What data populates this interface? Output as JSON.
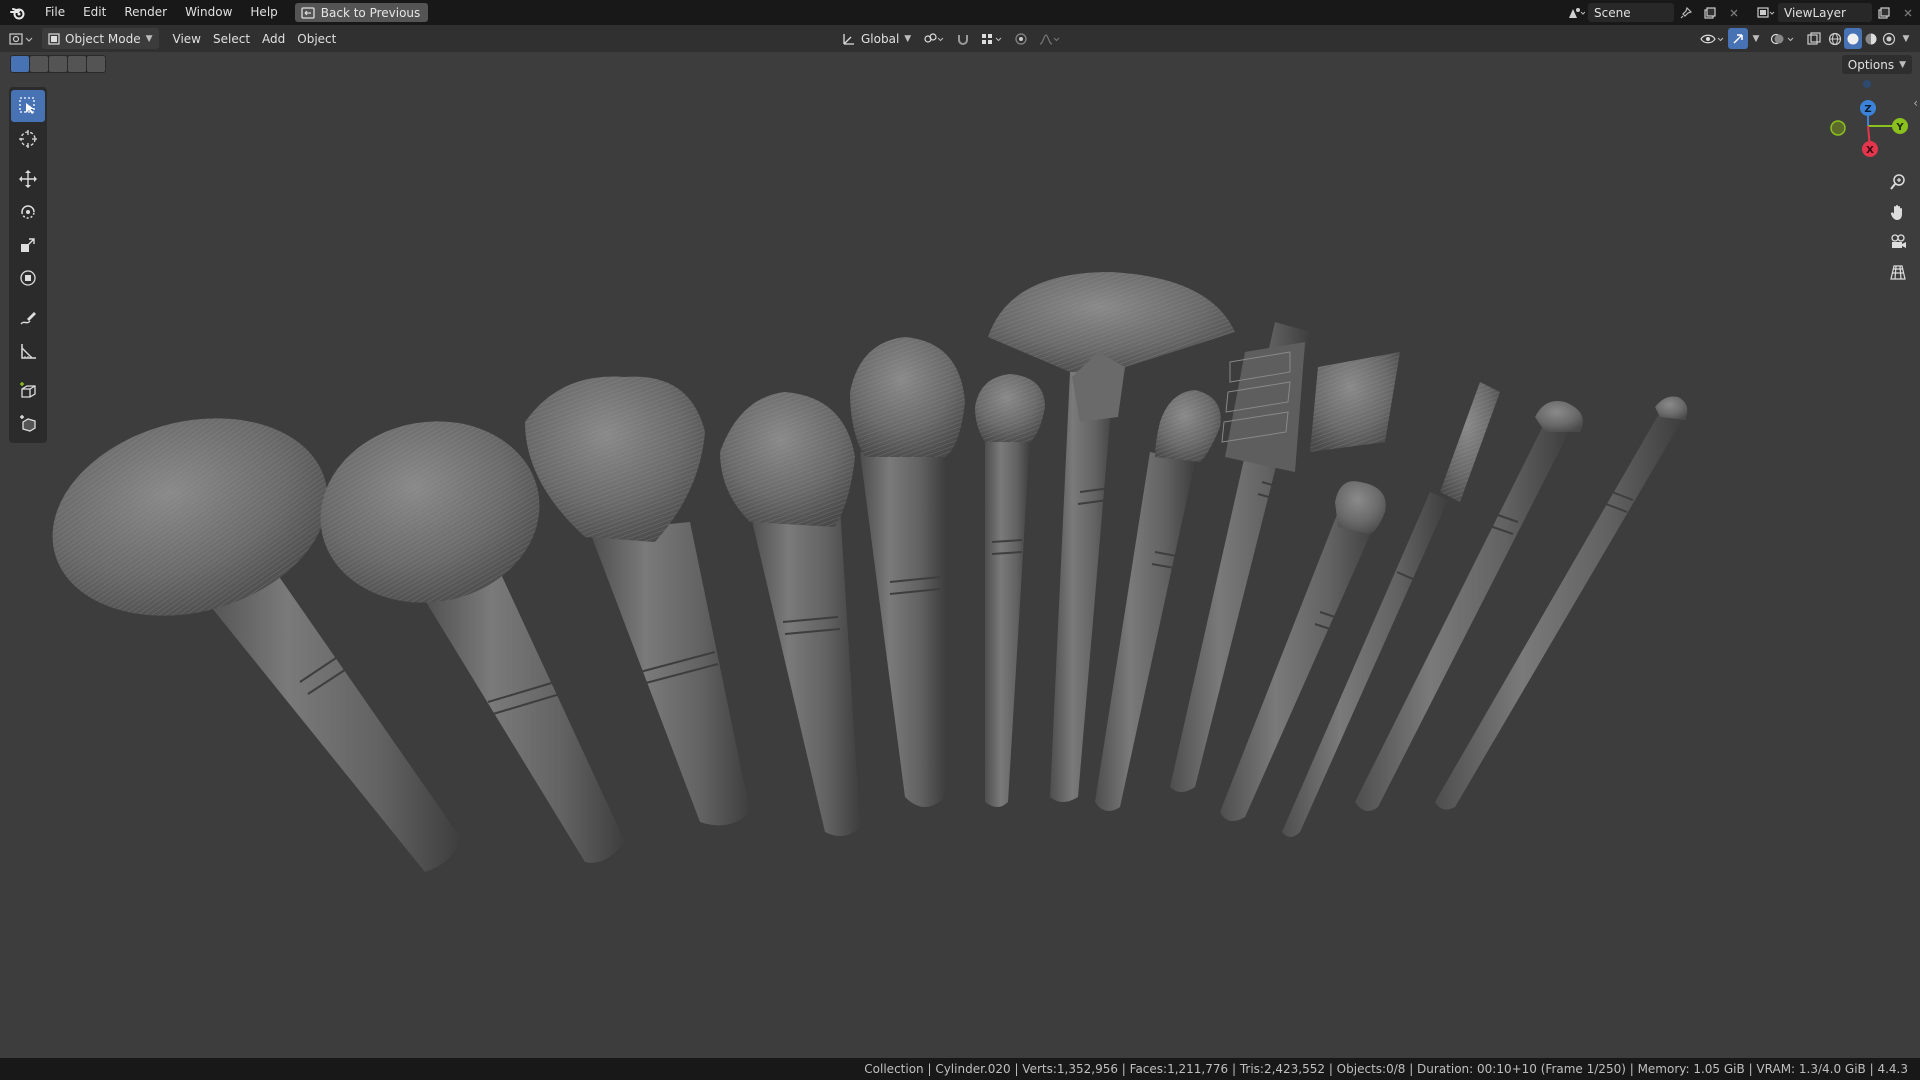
{
  "menubar": {
    "items": [
      "File",
      "Edit",
      "Render",
      "Window",
      "Help"
    ],
    "back_label": "Back to Previous",
    "scene_name": "Scene",
    "view_layer_name": "ViewLayer"
  },
  "header": {
    "mode_label": "Object Mode",
    "menus": [
      "View",
      "Select",
      "Add",
      "Object"
    ],
    "orientation_label": "Global"
  },
  "viewport": {
    "options_label": "Options",
    "gizmo": {
      "z": "Z",
      "y": "Y",
      "x": "X"
    }
  },
  "status": {
    "text": "Collection | Cylinder.020 | Verts:1,352,956 | Faces:1,211,776 | Tris:2,423,552 | Objects:0/8 | Duration: 00:10+10 (Frame 1/250) | Memory: 1.05 GiB | VRAM: 1.3/4.0 GiB | 4.4.3"
  },
  "colors": {
    "accent": "#4772b3",
    "axis_x": "#e2364c",
    "axis_y": "#8ac11f",
    "axis_z": "#3b83d9",
    "viewport_bg": "#3d3d3d"
  }
}
